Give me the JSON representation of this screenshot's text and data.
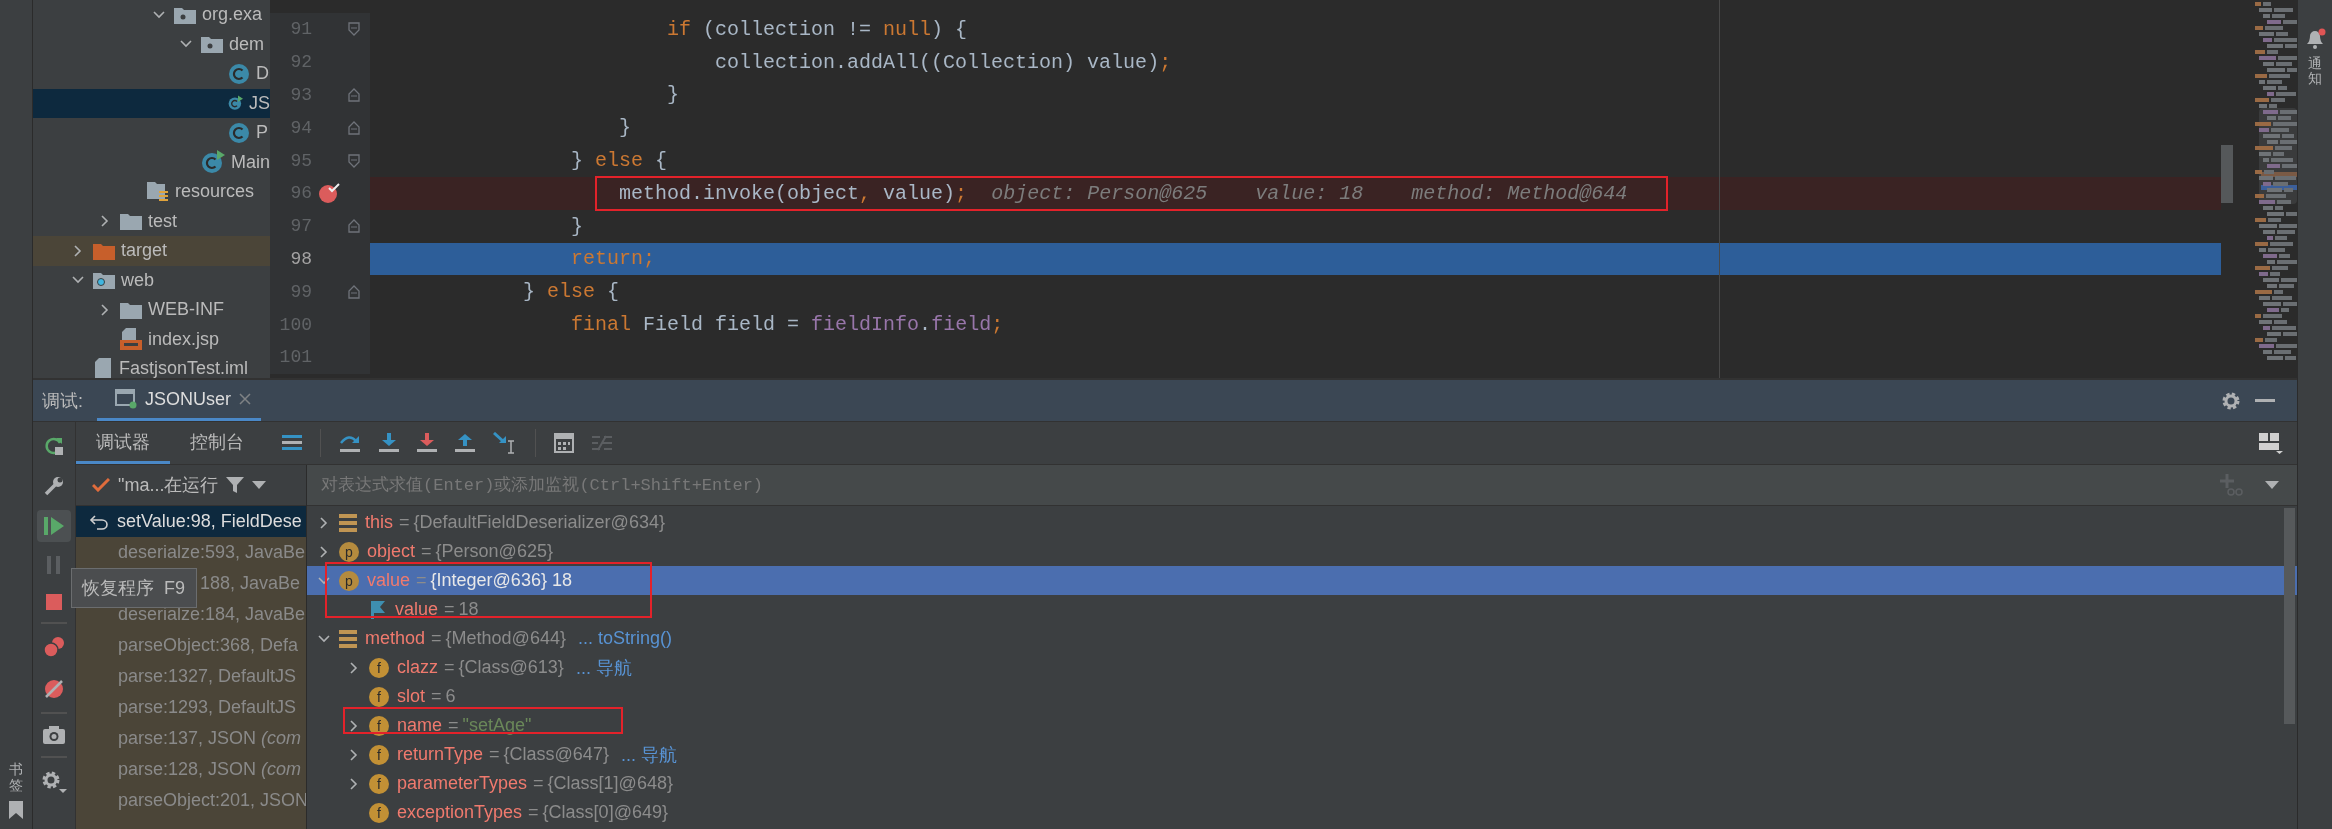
{
  "project_tree": {
    "items": [
      {
        "children": [
          {
            "children": [
              {
                "children": [
                  {
                    "label": "org.exa",
                    "kind": "package",
                    "expanded": true,
                    "selected": false,
                    "children": [
                      {
                        "label": "dem",
                        "kind": "package",
                        "expanded": true,
                        "selected": false,
                        "children": [
                          {
                            "label": "D",
                            "kind": "class",
                            "selected": false
                          },
                          {
                            "label": "JS",
                            "kind": "runnable_class",
                            "selected": true
                          },
                          {
                            "label": "P",
                            "kind": "class",
                            "selected": false
                          }
                        ]
                      },
                      {
                        "label": "Main",
                        "kind": "runnable_class",
                        "selected": false
                      }
                    ]
                  }
                ]
              },
              {
                "label": "resources",
                "kind": "resources_folder",
                "selected": false
              }
            ]
          },
          {
            "label": "test",
            "kind": "folder",
            "expanded": false,
            "selected": false
          }
        ]
      },
      {
        "label": "target",
        "kind": "excluded_folder",
        "expanded": false,
        "selected": false
      },
      {
        "label": "web",
        "kind": "web_folder",
        "expanded": true,
        "selected": false,
        "children": [
          {
            "label": "WEB-INF",
            "kind": "folder",
            "expanded": false,
            "selected": false
          },
          {
            "label": "index.jsp",
            "kind": "jsp",
            "selected": false
          }
        ]
      },
      {
        "label": "FastjsonTest.iml",
        "kind": "iml",
        "selected": false
      }
    ]
  },
  "editor": {
    "lines": [
      {
        "number": "91",
        "fold_start": true,
        "fold_end": false,
        "breakpoint": false,
        "current": false,
        "tokens": [
          {
            "t": "                        if",
            "kind": "keyword"
          },
          {
            "t": " (collection != ",
            "kind": "plain"
          },
          {
            "t": "null",
            "kind": "keyword"
          },
          {
            "t": ") {",
            "kind": "plain"
          }
        ]
      },
      {
        "number": "92",
        "fold_start": false,
        "fold_end": false,
        "breakpoint": false,
        "current": false,
        "tokens": [
          {
            "t": "                            collection.addAll((Collection) value)",
            "kind": "plain"
          },
          {
            "t": ";",
            "kind": "keyword"
          }
        ]
      },
      {
        "number": "93",
        "fold_start": false,
        "fold_end": true,
        "breakpoint": false,
        "current": false,
        "tokens": [
          {
            "t": "                        }",
            "kind": "plain"
          }
        ]
      },
      {
        "number": "94",
        "fold_start": false,
        "fold_end": true,
        "breakpoint": false,
        "current": false,
        "tokens": [
          {
            "t": "                    }",
            "kind": "plain"
          }
        ]
      },
      {
        "number": "95",
        "fold_start": true,
        "fold_end": false,
        "breakpoint": false,
        "current": false,
        "tokens": [
          {
            "t": "                } ",
            "kind": "plain"
          },
          {
            "t": "else",
            "kind": "keyword"
          },
          {
            "t": " {",
            "kind": "plain"
          }
        ]
      },
      {
        "number": "96",
        "fold_start": false,
        "fold_end": false,
        "breakpoint": true,
        "current": false,
        "marked": true,
        "tokens": [
          {
            "t": "                    method.invoke(object",
            "kind": "plain"
          },
          {
            "t": ",",
            "kind": "keyword"
          },
          {
            "t": " value)",
            "kind": "plain"
          },
          {
            "t": ";",
            "kind": "keyword"
          }
        ],
        "hint": "object: Person@625    value: 18    method: Method@644"
      },
      {
        "number": "97",
        "fold_start": false,
        "fold_end": true,
        "breakpoint": false,
        "current": false,
        "tokens": [
          {
            "t": "                }",
            "kind": "plain"
          }
        ]
      },
      {
        "number": "98",
        "fold_start": false,
        "fold_end": false,
        "breakpoint": false,
        "current": true,
        "tokens": [
          {
            "t": "                return",
            "kind": "keyword"
          },
          {
            "t": ";",
            "kind": "keyword"
          }
        ]
      },
      {
        "number": "99",
        "fold_start": false,
        "fold_end": true,
        "breakpoint": false,
        "current": false,
        "tokens": [
          {
            "t": "            } ",
            "kind": "plain"
          },
          {
            "t": "else",
            "kind": "keyword"
          },
          {
            "t": " {",
            "kind": "plain"
          }
        ]
      },
      {
        "number": "100",
        "fold_start": false,
        "fold_end": false,
        "breakpoint": false,
        "current": false,
        "tokens": [
          {
            "t": "                final",
            "kind": "keyword"
          },
          {
            "t": " Field field = ",
            "kind": "plain"
          },
          {
            "t": "fieldInfo",
            "kind": "field"
          },
          {
            "t": ".",
            "kind": "plain"
          },
          {
            "t": "field",
            "kind": "field"
          },
          {
            "t": ";",
            "kind": "keyword"
          }
        ]
      },
      {
        "number": "101",
        "fold_start": false,
        "fold_end": false,
        "breakpoint": false,
        "current": false
      }
    ]
  },
  "debugger": {
    "title": "调试:",
    "tabs": [
      {
        "label": "JSONUser",
        "selected": true
      }
    ],
    "subtabs": [
      {
        "label": "调试器",
        "selected": true
      },
      {
        "label": "控制台",
        "selected": false
      }
    ],
    "thread": "\"ma...在运行",
    "evaluate": {
      "placeholder": "对表达式求值(Enter)或添加监视(Ctrl+Shift+Enter)"
    },
    "frames": [
      {
        "label": "setValue:98, FieldDese",
        "kind": "current",
        "selected": true
      },
      {
        "label": "deserialze:593, JavaBe",
        "kind": "library",
        "selected": false
      },
      {
        "label": "188, JavaBe",
        "kind": "covered",
        "selected": false
      },
      {
        "label": "deserialze:184, JavaBe",
        "kind": "library",
        "selected": false
      },
      {
        "label": "parseObject:368, Defa",
        "kind": "library",
        "selected": false
      },
      {
        "label": "parse:1327, DefaultJS",
        "kind": "library",
        "selected": false
      },
      {
        "label": "parse:1293, DefaultJS",
        "kind": "library",
        "selected": false
      },
      {
        "label": "parse:137, JSON *(com*",
        "kind": "library",
        "selected": false
      },
      {
        "label": "parse:128, JSON *(com*",
        "kind": "library",
        "selected": false
      },
      {
        "label": "parseObject:201, JSON",
        "kind": "library",
        "selected": false
      }
    ],
    "tooltip": {
      "text": "恢复程序",
      "shortcut": "F9"
    },
    "variables": [
      {
        "name": "this",
        "sep": "=",
        "value": "{DefaultFieldDeserializer@634}",
        "kind": "local",
        "expanded": false,
        "selected": false
      },
      {
        "name": "object",
        "sep": "=",
        "value": "{Person@625}",
        "kind": "param",
        "badge": "p",
        "expanded": false,
        "selected": false
      },
      {
        "name": "value",
        "sep": "=",
        "value": "{Integer@636} 18",
        "kind": "param",
        "badge": "p",
        "expanded": true,
        "selected": true,
        "marked": true,
        "children": [
          {
            "name": "value",
            "sep": "=",
            "value": "18",
            "kind": "primitive",
            "selected": false
          }
        ]
      },
      {
        "name": "method",
        "sep": "=",
        "value": "{Method@644}",
        "link": "... toString()",
        "kind": "local",
        "expanded": true,
        "selected": false,
        "children": [
          {
            "name": "clazz",
            "sep": "=",
            "value": "{Class@613}",
            "link": "... 导航",
            "kind": "field",
            "badge": "f",
            "expanded": false,
            "selected": false
          },
          {
            "name": "slot",
            "sep": "=",
            "value": "6",
            "kind": "field",
            "badge": "f",
            "selected": false
          },
          {
            "name": "name",
            "sep": "=",
            "value": "\"setAge\"",
            "kind": "string_field",
            "badge": "f",
            "expanded": false,
            "selected": false,
            "marked": true
          },
          {
            "name": "returnType",
            "sep": "=",
            "value": "{Class@647}",
            "link": "... 导航",
            "kind": "field",
            "badge": "f",
            "expanded": false,
            "selected": false
          },
          {
            "name": "parameterTypes",
            "sep": "=",
            "value": "{Class[1]@648}",
            "kind": "field",
            "badge": "f",
            "expanded": false,
            "selected": false
          },
          {
            "name": "exceptionTypes",
            "sep": "=",
            "value": "{Class[0]@649}",
            "kind": "field",
            "badge": "f",
            "selected": false
          }
        ]
      }
    ]
  },
  "left_stripe": {
    "bookmarks": "书签"
  },
  "right_stripe": {
    "notifications": "通知"
  }
}
